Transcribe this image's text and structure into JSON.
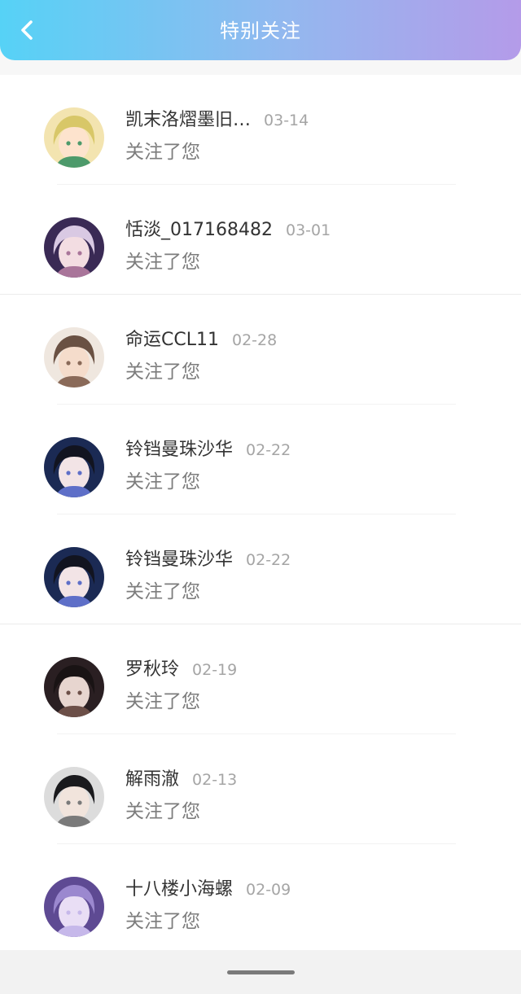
{
  "header": {
    "title": "特别关注",
    "back_icon": "chevron-left-icon"
  },
  "colors": {
    "header_gradient": [
      "#56d2f6",
      "#93b8ef",
      "#b49be9"
    ],
    "name_text": "#333333",
    "date_text": "#a5a5a5",
    "action_text": "#7d7d7d"
  },
  "items": [
    {
      "name": "凯末洛熠墨旧…",
      "date": "03-14",
      "action": "关注了您",
      "avatar": {
        "bg": "#f3e4b0",
        "hair": "#d8c768",
        "accent": "#4d9a6b",
        "face": "#fde3cd"
      }
    },
    {
      "name": "恬淡_017168482",
      "date": "03-01",
      "action": "关注了您",
      "avatar": {
        "bg": "#3a2a55",
        "hair": "#d9c9e3",
        "accent": "#a9759a",
        "face": "#f3dde2"
      }
    },
    {
      "name": "命运CCL11",
      "date": "02-28",
      "action": "关注了您",
      "avatar": {
        "bg": "#efe7df",
        "hair": "#6a5143",
        "accent": "#8a6a59",
        "face": "#f5dccb"
      }
    },
    {
      "name": "铃铛曼珠沙华",
      "date": "02-22",
      "action": "关注了您",
      "avatar": {
        "bg": "#1b2a54",
        "hair": "#121420",
        "accent": "#5e6fc8",
        "face": "#f2e4e6"
      }
    },
    {
      "name": "铃铛曼珠沙华",
      "date": "02-22",
      "action": "关注了您",
      "avatar": {
        "bg": "#1b2a54",
        "hair": "#121420",
        "accent": "#5e6fc8",
        "face": "#f2e4e6"
      }
    },
    {
      "name": "罗秋玲",
      "date": "02-19",
      "action": "关注了您",
      "avatar": {
        "bg": "#2a1f22",
        "hair": "#191314",
        "accent": "#6c4f48",
        "face": "#e7d5cf"
      }
    },
    {
      "name": "解雨澈",
      "date": "02-13",
      "action": "关注了您",
      "avatar": {
        "bg": "#dcdcdc",
        "hair": "#1a1a1d",
        "accent": "#7a7a7a",
        "face": "#f1e4dc"
      }
    },
    {
      "name": "十八楼小海螺",
      "date": "02-09",
      "action": "关注了您",
      "avatar": {
        "bg": "#5e4a93",
        "hair": "#9b88cf",
        "accent": "#c6b8ea",
        "face": "#e9def5"
      }
    }
  ]
}
